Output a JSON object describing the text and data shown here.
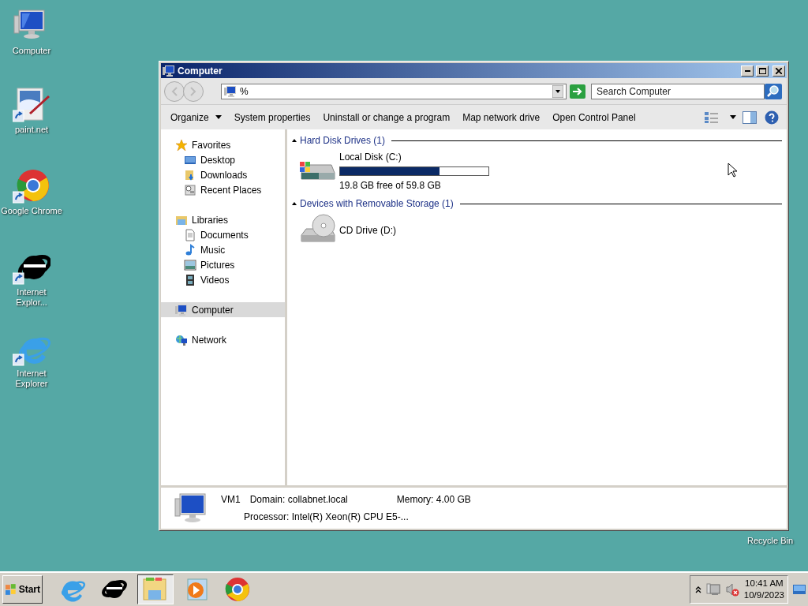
{
  "desktop_icons": [
    {
      "label": "Computer"
    },
    {
      "label": "paint.net"
    },
    {
      "label": "Google Chrome"
    },
    {
      "label": "Internet Explor..."
    },
    {
      "label": "Internet Explorer"
    }
  ],
  "recycle_bin": {
    "label": "Recycle Bin"
  },
  "window": {
    "title": "Computer",
    "address": {
      "value": "%"
    },
    "search": {
      "placeholder": "Search Computer"
    },
    "toolbar": [
      {
        "label": "Organize",
        "dropdown": true
      },
      {
        "label": "System properties",
        "dropdown": false
      },
      {
        "label": "Uninstall or change a program",
        "dropdown": false
      },
      {
        "label": "Map network drive",
        "dropdown": false
      },
      {
        "label": "Open Control Panel",
        "dropdown": false
      }
    ],
    "nav": [
      {
        "label": "Favorites",
        "selected": false,
        "children": [
          {
            "label": "Desktop",
            "selected": false
          },
          {
            "label": "Downloads",
            "selected": false
          },
          {
            "label": "Recent Places",
            "selected": false
          }
        ]
      },
      {
        "label": "Libraries",
        "selected": false,
        "children": [
          {
            "label": "Documents",
            "selected": false
          },
          {
            "label": "Music",
            "selected": false
          },
          {
            "label": "Pictures",
            "selected": false
          },
          {
            "label": "Videos",
            "selected": false
          }
        ]
      },
      {
        "label": "Computer",
        "selected": true
      },
      {
        "label": "Network",
        "selected": false
      }
    ],
    "sections": [
      {
        "title": "Hard Disk Drives (1)",
        "drives": [
          {
            "kind": "disk",
            "name": "Local Disk (C:)",
            "level": 0.67,
            "free": "19.8 GB free of 59.8 GB"
          }
        ]
      },
      {
        "title": "Devices with Removable Storage (1)",
        "drives": [
          {
            "kind": "cd",
            "name": "CD Drive (D:)"
          }
        ]
      }
    ],
    "details": {
      "name": "VM1",
      "domain": "Domain: collabnet.local",
      "memory": "Memory: 4.00 GB",
      "processor": "Processor: Intel(R) Xeon(R) CPU E5-..."
    }
  },
  "taskbar": {
    "start": "Start",
    "buttons": [
      {
        "selected": false
      },
      {
        "selected": false
      },
      {
        "selected": true
      },
      {
        "selected": false
      },
      {
        "selected": false
      }
    ],
    "clock": {
      "time": "10:41 AM",
      "date": "10/9/2023"
    }
  }
}
